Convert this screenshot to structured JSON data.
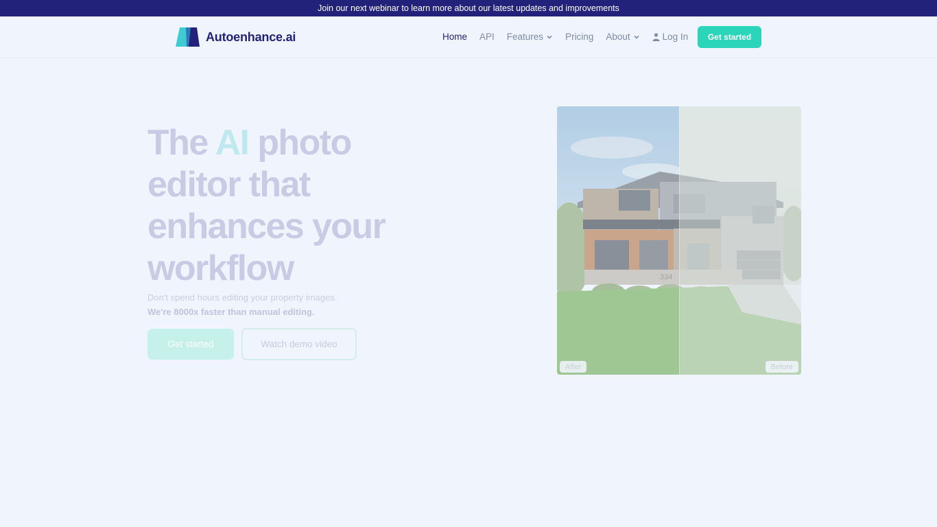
{
  "announcement": {
    "text": "Join our next webinar to learn more about our latest updates and improvements"
  },
  "header": {
    "brand": "Autoenhance.ai",
    "nav": {
      "home": "Home",
      "api": "API",
      "features": "Features",
      "pricing": "Pricing",
      "about": "About",
      "login": "Log In"
    },
    "cta": "Get started"
  },
  "hero": {
    "title_before": "The ",
    "title_ai": "AI",
    "title_after": " photo editor that enhances your workflow",
    "subtitle": "Don't spend hours editing your property images.",
    "subtitle_bold": "We're 8000x faster than manual editing.",
    "primary_button": "Get started",
    "secondary_button": "Watch demo video"
  },
  "comparison": {
    "after_label": "After",
    "before_label": "Before",
    "house_number": "334"
  },
  "colors": {
    "announcement_bg": "#23227a",
    "brand_navy": "#23227a",
    "accent_teal": "#2ad5ba",
    "page_bg": "#f0f5fd"
  }
}
